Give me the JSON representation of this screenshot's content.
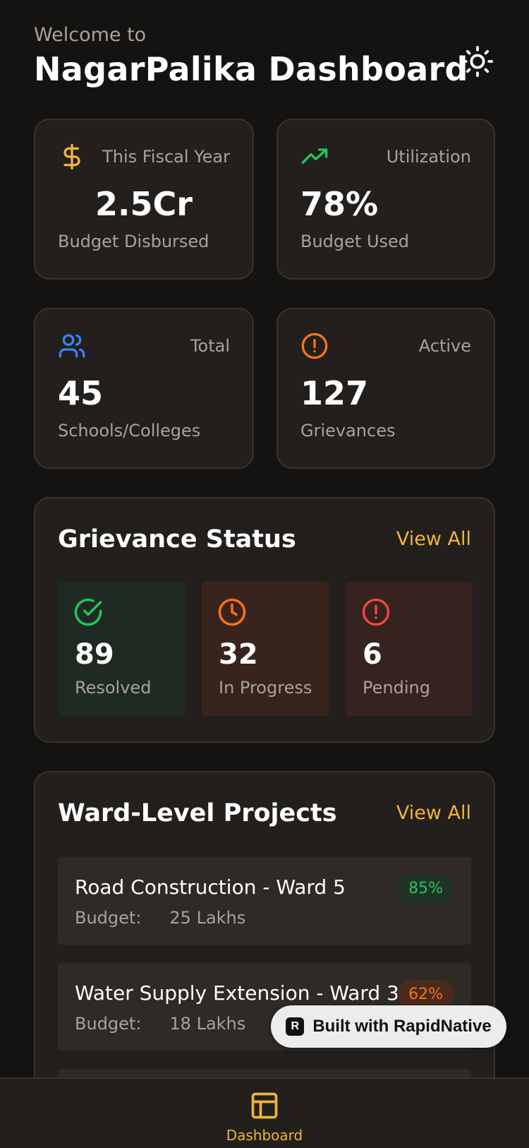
{
  "header": {
    "welcome": "Welcome to",
    "title": "NagarPalika Dashboard"
  },
  "stats": [
    {
      "icon": "dollar-icon",
      "top_label": "This Fiscal Year",
      "value": "2.5Cr",
      "caption": "Budget Disbursed",
      "color": "#f0b43a"
    },
    {
      "icon": "trending-up-icon",
      "top_label": "Utilization",
      "value": "78%",
      "caption": "Budget Used",
      "color": "#22c55e"
    },
    {
      "icon": "users-icon",
      "top_label": "Total",
      "value": "45",
      "caption": "Schools/Colleges",
      "color": "#3b82f6"
    },
    {
      "icon": "alert-circle-icon",
      "top_label": "Active",
      "value": "127",
      "caption": "Grievances",
      "color": "#f97316"
    }
  ],
  "grievance": {
    "title": "Grievance Status",
    "view_all": "View All",
    "items": [
      {
        "icon": "check-circle-icon",
        "value": "89",
        "label": "Resolved",
        "color": "#22c55e"
      },
      {
        "icon": "clock-icon",
        "value": "32",
        "label": "In Progress",
        "color": "#f97316"
      },
      {
        "icon": "alert-circle-icon",
        "value": "6",
        "label": "Pending",
        "color": "#ef4444"
      }
    ]
  },
  "projects": {
    "title": "Ward-Level Projects",
    "view_all": "View All",
    "items": [
      {
        "name": "Road Construction - Ward 5",
        "budget_label": "Budget:",
        "budget": "25 Lakhs",
        "progress": "85%",
        "color": "#22c55e"
      },
      {
        "name": "Water Supply Extension - Ward 3",
        "budget_label": "Budget:",
        "budget": "18 Lakhs",
        "progress": "62%",
        "color": "#f97316"
      }
    ]
  },
  "badge": {
    "text": "Built with RapidNative"
  },
  "nav": {
    "dashboard": "Dashboard"
  },
  "colors": {
    "accent": "#f0b43a",
    "background": "#151311",
    "card": "#221f1c"
  }
}
